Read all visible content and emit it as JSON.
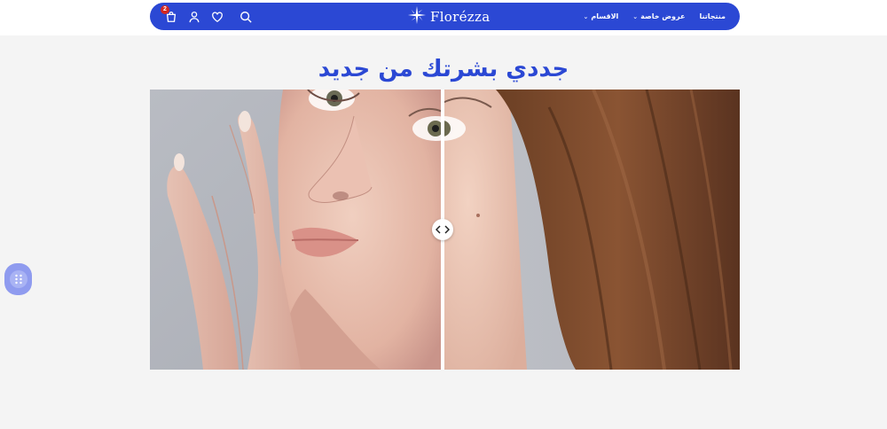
{
  "header": {
    "logo_text": "Florézza",
    "cart_count": "2",
    "nav": [
      {
        "label": "منتجاتنا",
        "has_dropdown": false
      },
      {
        "label": "عروض خاصة",
        "has_dropdown": true
      },
      {
        "label": "الاقسام",
        "has_dropdown": true
      },
      {
        "label": "",
        "has_dropdown": false
      }
    ],
    "icons": [
      "cart-icon",
      "user-icon",
      "heart-icon",
      "search-icon"
    ]
  },
  "hero": {
    "title": "جددي بشرتك من جديد"
  },
  "comparison": {
    "split_position": 0.5,
    "handle_icon": "chevrons-left-right-icon"
  },
  "colors": {
    "brand_blue": "#2b48d4",
    "accent_red": "#e0302b",
    "page_bg": "#f4f4f4",
    "widget_bg": "#8f9bef"
  }
}
